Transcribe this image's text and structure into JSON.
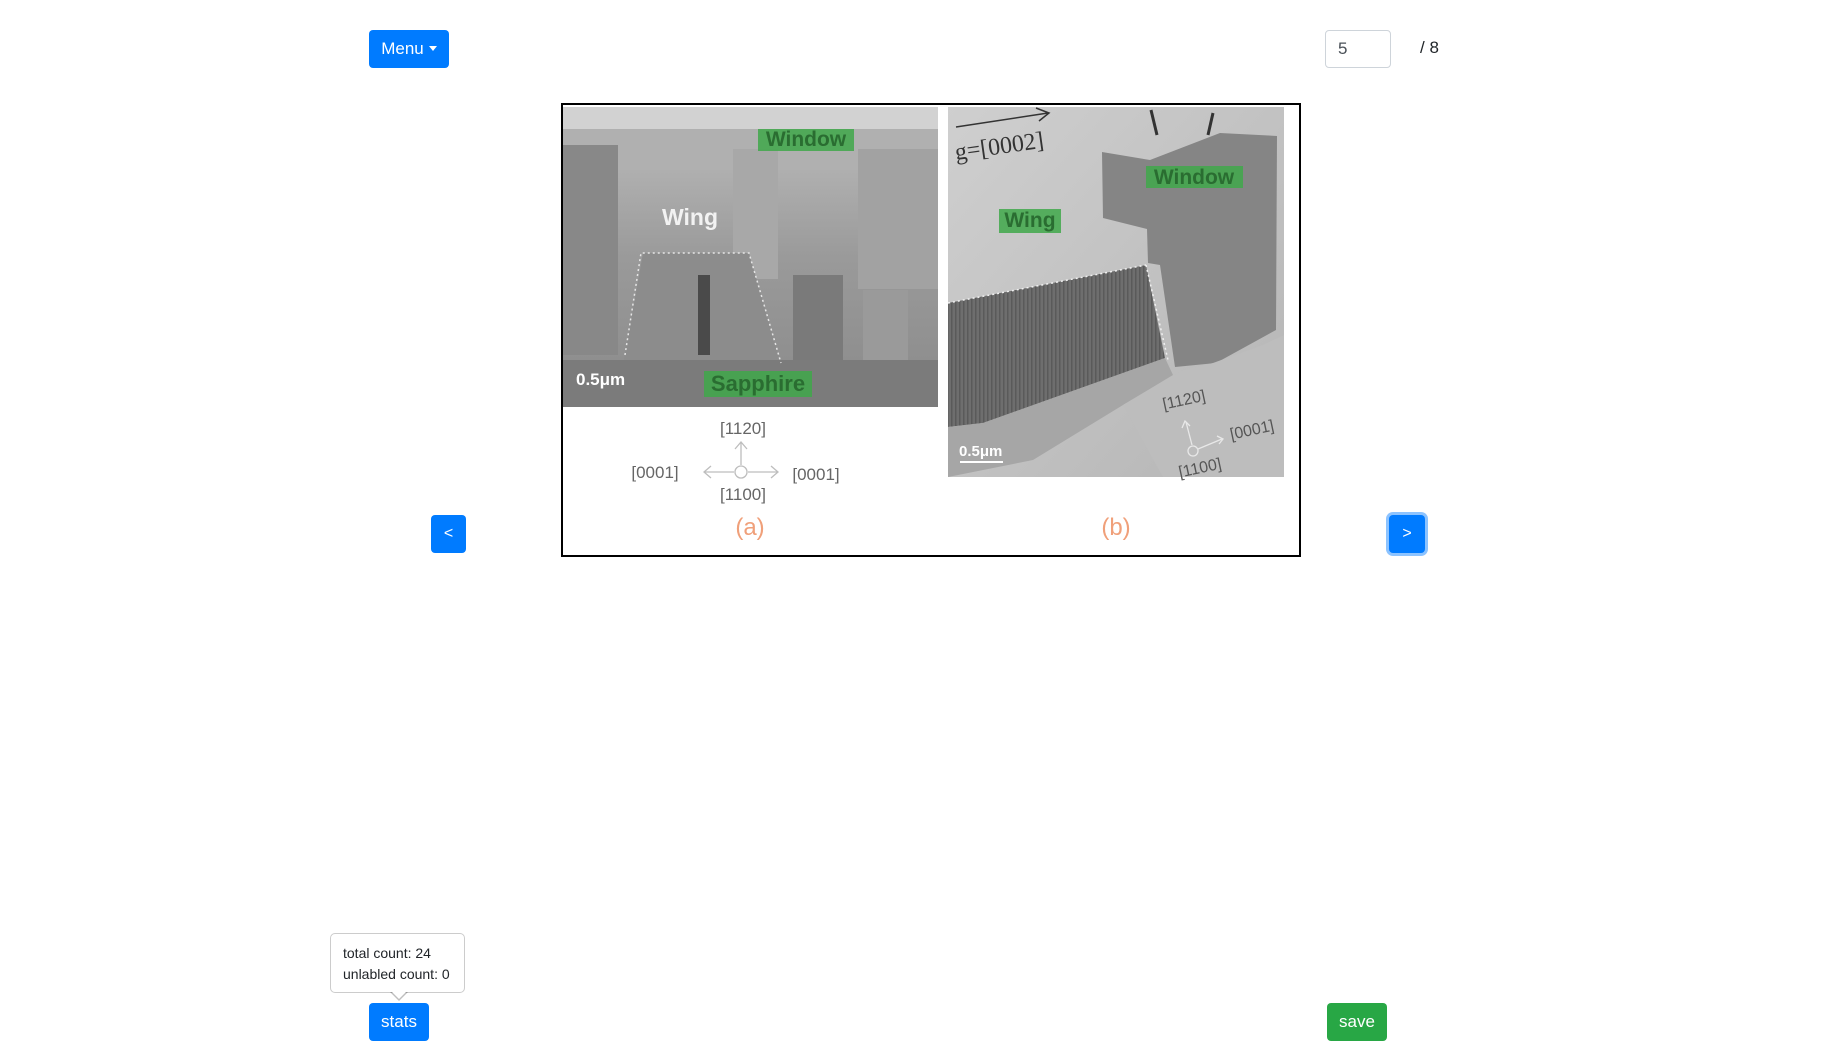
{
  "toolbar": {
    "menu_label": "Menu",
    "page_current": "5",
    "page_total": "/ 8"
  },
  "navigation": {
    "prev_label": "<",
    "next_label": ">"
  },
  "figure": {
    "panel_a": {
      "labels": {
        "window": "Window",
        "wing": "Wing",
        "sapphire": "Sapphire",
        "scale": "0.5μm"
      },
      "axes": {
        "up": "[1120]",
        "down": "[1100]",
        "left": "[0001]",
        "right": "[0001]"
      },
      "caption": "(a)"
    },
    "panel_b": {
      "labels": {
        "g_vector": "g=[0002]",
        "window": "Window",
        "wing": "Wing",
        "scale": "0.5μm"
      },
      "axes": {
        "up": "[1120]",
        "right": "[0001]",
        "down": "[1100]"
      },
      "caption": "(b)"
    },
    "colors": {
      "highlight": "#3fa84a",
      "caption": "#f0a07a"
    }
  },
  "stats": {
    "button_label": "stats",
    "total_count": "total count: 24",
    "unlabeled_count": "unlabled count: 0"
  },
  "actions": {
    "save_label": "save"
  }
}
